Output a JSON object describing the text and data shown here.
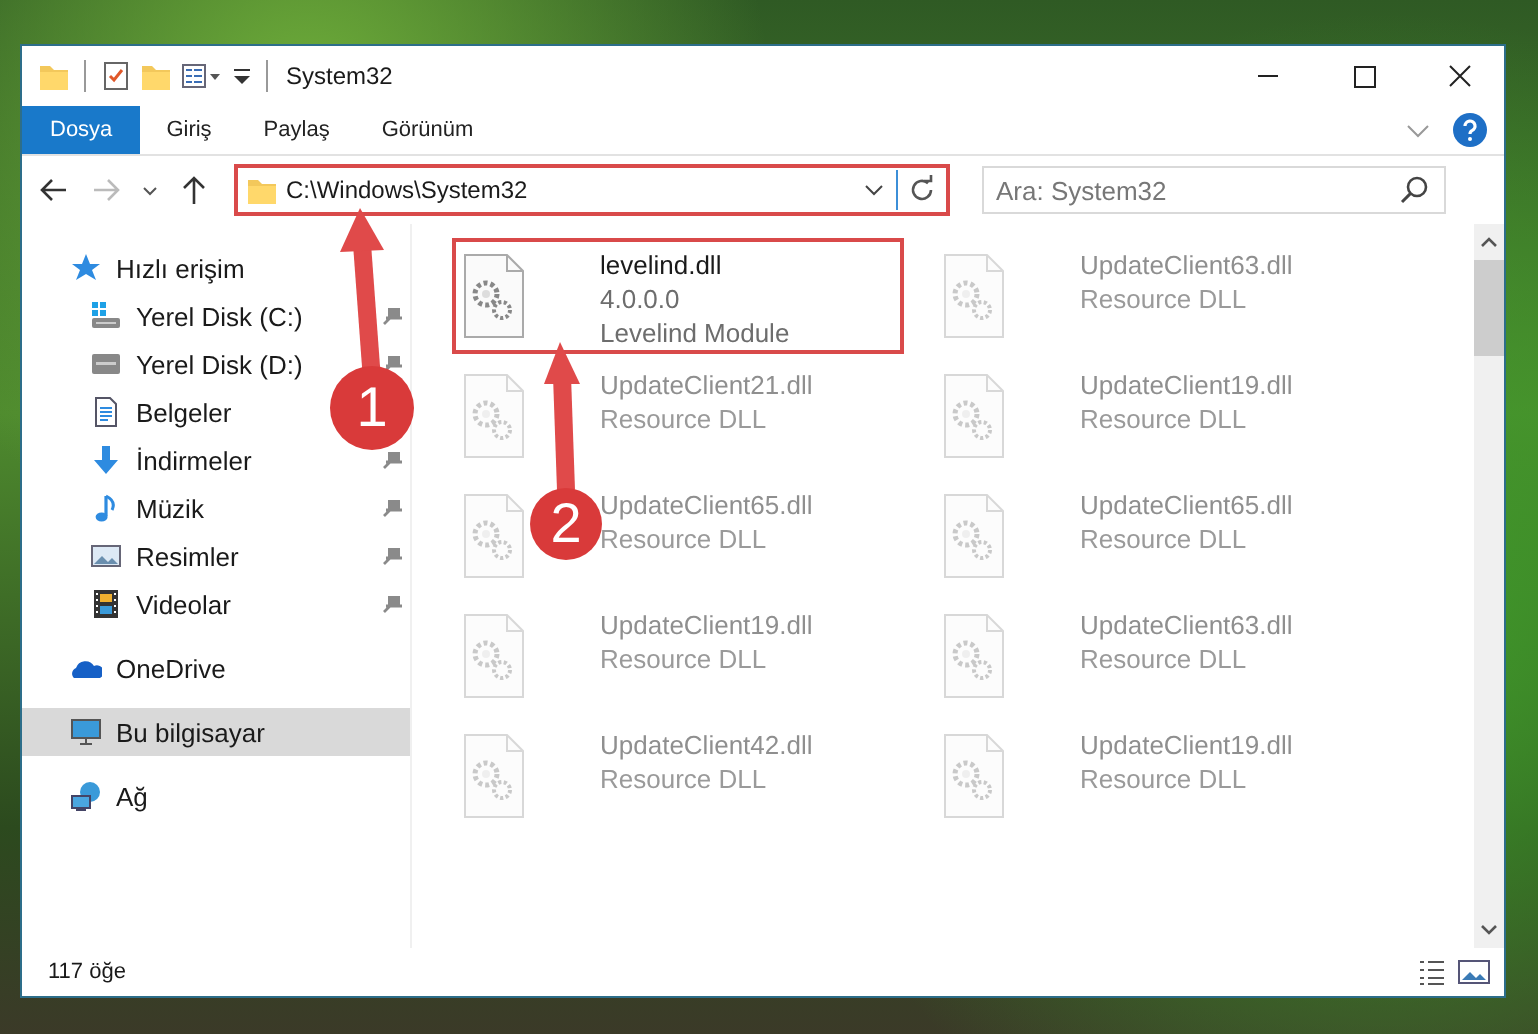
{
  "window": {
    "title": "System32"
  },
  "ribbon_tabs": [
    {
      "label": "Dosya",
      "selected": true
    },
    {
      "label": "Giriş",
      "selected": false
    },
    {
      "label": "Paylaş",
      "selected": false
    },
    {
      "label": "Görünüm",
      "selected": false
    }
  ],
  "address": {
    "path": "C:\\Windows\\System32",
    "highlighted": true
  },
  "search": {
    "placeholder": "Ara: System32"
  },
  "quick_access": {
    "label": "Hızlı erişim",
    "children": [
      {
        "label": "Yerel Disk (C:)",
        "pinned": true
      },
      {
        "label": "Yerel Disk (D:)",
        "pinned": true
      },
      {
        "label": "Belgeler",
        "pinned": false
      },
      {
        "label": "İndirmeler",
        "pinned": true
      },
      {
        "label": "Müzik",
        "pinned": true
      },
      {
        "label": "Resimler",
        "pinned": true
      },
      {
        "label": "Videolar",
        "pinned": true
      }
    ]
  },
  "locations": [
    {
      "label": "OneDrive",
      "selected": false
    },
    {
      "label": "Bu bilgisayar",
      "selected": true
    },
    {
      "label": "Ağ",
      "selected": false
    }
  ],
  "files": [
    {
      "name": "levelind.dll",
      "details": [
        "4.0.0.0",
        "Levelind Module"
      ],
      "highlighted": true,
      "faded": false
    },
    {
      "name": "UpdateClient63.dll",
      "details": [
        "Resource DLL"
      ],
      "highlighted": false,
      "faded": true
    },
    {
      "name": "UpdateClient21.dll",
      "details": [
        "Resource DLL"
      ],
      "highlighted": false,
      "faded": true
    },
    {
      "name": "UpdateClient19.dll",
      "details": [
        "Resource DLL"
      ],
      "highlighted": false,
      "faded": true
    },
    {
      "name": "UpdateClient65.dll",
      "details": [
        "Resource DLL"
      ],
      "highlighted": false,
      "faded": true
    },
    {
      "name": "UpdateClient65.dll",
      "details": [
        "Resource DLL"
      ],
      "highlighted": false,
      "faded": true
    },
    {
      "name": "UpdateClient19.dll",
      "details": [
        "Resource DLL"
      ],
      "highlighted": false,
      "faded": true
    },
    {
      "name": "UpdateClient63.dll",
      "details": [
        "Resource DLL"
      ],
      "highlighted": false,
      "faded": true
    },
    {
      "name": "UpdateClient42.dll",
      "details": [
        "Resource DLL"
      ],
      "highlighted": false,
      "faded": true
    },
    {
      "name": "UpdateClient19.dll",
      "details": [
        "Resource DLL"
      ],
      "highlighted": false,
      "faded": true
    }
  ],
  "status_bar": {
    "count": "117 öğe"
  },
  "annotations": [
    {
      "number": "1"
    },
    {
      "number": "2"
    }
  ]
}
